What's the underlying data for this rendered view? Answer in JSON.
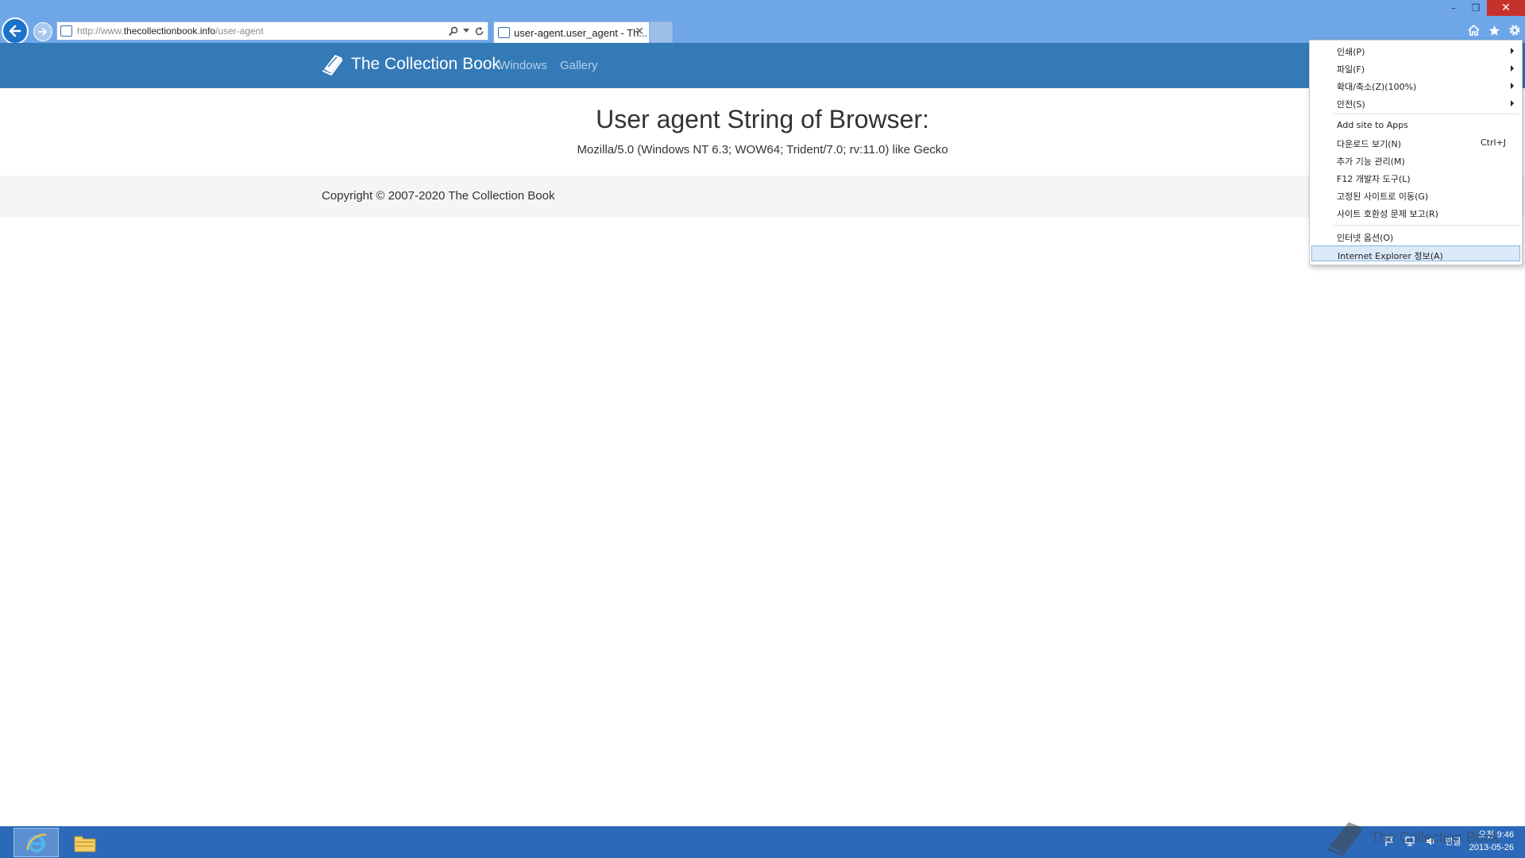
{
  "browser": {
    "address_prefix": "http://www.",
    "address_domain": "thecollectionbook.info",
    "address_path": "/user-agent",
    "tab_title": "user-agent.user_agent - Th...",
    "tab_close": "✕"
  },
  "window_controls": {
    "minimize": "–",
    "restore": "❐",
    "close": "✕"
  },
  "site": {
    "brand": "The Collection Book",
    "nav": [
      "Windows",
      "Gallery"
    ]
  },
  "main": {
    "heading": "User agent String of Browser:",
    "user_agent": "Mozilla/5.0 (Windows NT 6.3; WOW64; Trident/7.0; rv:11.0) like Gecko"
  },
  "footer": {
    "copyright": "Copyright © 2007-2020 The Collection Book"
  },
  "tools_menu": {
    "items": [
      {
        "label": "인쇄(P)",
        "submenu": true
      },
      {
        "label": "파일(F)",
        "submenu": true
      },
      {
        "label": "확대/축소(Z)(100%)",
        "submenu": true
      },
      {
        "label": "안전(S)",
        "submenu": true
      },
      {
        "label": "Add site to Apps"
      },
      {
        "label": "다운로드 보기(N)",
        "shortcut": "Ctrl+J"
      },
      {
        "label": "추가 기능 관리(M)"
      },
      {
        "label": "F12 개발자 도구(L)"
      },
      {
        "label": "고정된 사이트로 이동(G)"
      },
      {
        "label": "사이트 호환성 문제 보고(R)"
      },
      {
        "label": "인터넷 옵션(O)"
      },
      {
        "label": "Internet Explorer 정보(A)",
        "highlighted": true
      }
    ]
  },
  "taskbar": {
    "ime": "한글",
    "time": "오전 9:46",
    "date": "2013-05-26",
    "watermark": "The Collection Book"
  },
  "colors": {
    "chrome": "#6fa6e8",
    "navbar": "#337ab7",
    "taskbar": "#2c69b8",
    "close_button": "#c7312b",
    "menu_highlight": "#dbe9f8"
  }
}
